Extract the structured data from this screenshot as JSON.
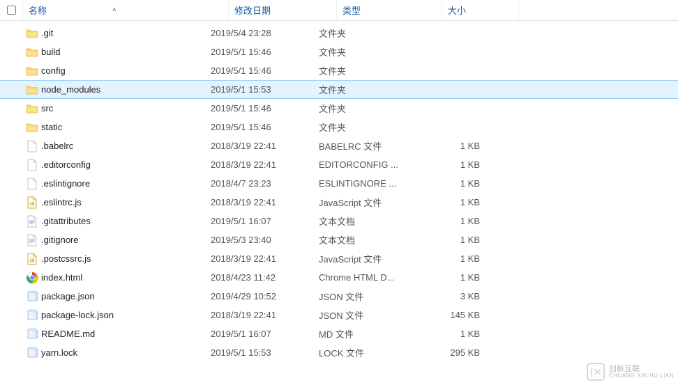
{
  "header": {
    "name": "名称",
    "date": "修改日期",
    "type": "类型",
    "size": "大小"
  },
  "rows": [
    {
      "icon": "folder",
      "name": ".git",
      "date": "2019/5/4 23:28",
      "type": "文件夹",
      "size": "",
      "selected": false
    },
    {
      "icon": "folder",
      "name": "build",
      "date": "2019/5/1 15:46",
      "type": "文件夹",
      "size": "",
      "selected": false
    },
    {
      "icon": "folder",
      "name": "config",
      "date": "2019/5/1 15:46",
      "type": "文件夹",
      "size": "",
      "selected": false
    },
    {
      "icon": "folder",
      "name": "node_modules",
      "date": "2019/5/1 15:53",
      "type": "文件夹",
      "size": "",
      "selected": true
    },
    {
      "icon": "folder",
      "name": "src",
      "date": "2019/5/1 15:46",
      "type": "文件夹",
      "size": "",
      "selected": false
    },
    {
      "icon": "folder",
      "name": "static",
      "date": "2019/5/1 15:46",
      "type": "文件夹",
      "size": "",
      "selected": false
    },
    {
      "icon": "blank",
      "name": ".babelrc",
      "date": "2018/3/19 22:41",
      "type": "BABELRC 文件",
      "size": "1 KB",
      "selected": false
    },
    {
      "icon": "blank",
      "name": ".editorconfig",
      "date": "2018/3/19 22:41",
      "type": "EDITORCONFIG ...",
      "size": "1 KB",
      "selected": false
    },
    {
      "icon": "blank",
      "name": ".eslintignore",
      "date": "2018/4/7 23:23",
      "type": "ESLINTIGNORE ...",
      "size": "1 KB",
      "selected": false
    },
    {
      "icon": "js",
      "name": ".eslintrc.js",
      "date": "2018/3/19 22:41",
      "type": "JavaScript 文件",
      "size": "1 KB",
      "selected": false
    },
    {
      "icon": "text",
      "name": ".gitattributes",
      "date": "2019/5/1 16:07",
      "type": "文本文档",
      "size": "1 KB",
      "selected": false
    },
    {
      "icon": "text",
      "name": ".gitignore",
      "date": "2019/5/3 23:40",
      "type": "文本文档",
      "size": "1 KB",
      "selected": false
    },
    {
      "icon": "js",
      "name": ".postcssrc.js",
      "date": "2018/3/19 22:41",
      "type": "JavaScript 文件",
      "size": "1 KB",
      "selected": false
    },
    {
      "icon": "chrome",
      "name": "index.html",
      "date": "2018/4/23 11:42",
      "type": "Chrome HTML D...",
      "size": "1 KB",
      "selected": false
    },
    {
      "icon": "file3d",
      "name": "package.json",
      "date": "2019/4/29 10:52",
      "type": "JSON 文件",
      "size": "3 KB",
      "selected": false
    },
    {
      "icon": "file3d",
      "name": "package-lock.json",
      "date": "2018/3/19 22:41",
      "type": "JSON 文件",
      "size": "145 KB",
      "selected": false
    },
    {
      "icon": "file3d",
      "name": "README.md",
      "date": "2019/5/1 16:07",
      "type": "MD 文件",
      "size": "1 KB",
      "selected": false
    },
    {
      "icon": "file3d",
      "name": "yarn.lock",
      "date": "2019/5/1 15:53",
      "type": "LOCK 文件",
      "size": "295 KB",
      "selected": false
    }
  ],
  "watermark": {
    "brand": "创新互联",
    "sub": "CHUANG XIN HU LIAN"
  }
}
